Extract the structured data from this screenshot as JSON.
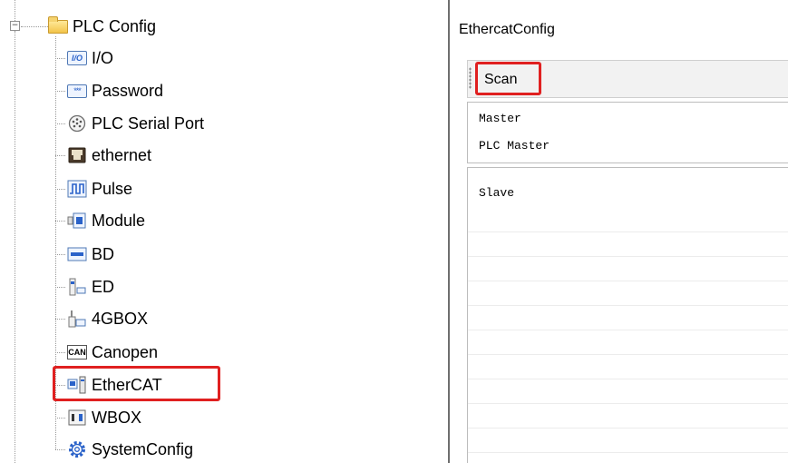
{
  "tree": {
    "root": {
      "label": "PLC Config",
      "expander": "−",
      "icon": "folder-icon"
    },
    "items": [
      {
        "label": "I/O",
        "icon": "io-icon",
        "icon_text": "I/O"
      },
      {
        "label": "Password",
        "icon": "password-icon",
        "icon_text": "***"
      },
      {
        "label": "PLC Serial Port",
        "icon": "serial-port-icon"
      },
      {
        "label": "ethernet",
        "icon": "ethernet-icon"
      },
      {
        "label": "Pulse",
        "icon": "pulse-icon"
      },
      {
        "label": "Module",
        "icon": "module-icon"
      },
      {
        "label": "BD",
        "icon": "bd-icon"
      },
      {
        "label": "ED",
        "icon": "ed-icon"
      },
      {
        "label": "4GBOX",
        "icon": "4gbox-icon"
      },
      {
        "label": "Canopen",
        "icon": "canopen-icon",
        "icon_text": "CAN"
      },
      {
        "label": "EtherCAT",
        "icon": "ethercat-icon",
        "highlighted": true
      },
      {
        "label": "WBOX",
        "icon": "wbox-icon"
      },
      {
        "label": "SystemConfig",
        "icon": "gear-icon"
      }
    ]
  },
  "config_panel": {
    "title": "EthercatConfig",
    "toolbar": {
      "scan_label": "Scan",
      "highlighted": true
    },
    "master_section": {
      "header": "Master",
      "rows": [
        "PLC Master"
      ]
    },
    "slave_section": {
      "header": "Slave",
      "rows": []
    }
  },
  "colors": {
    "highlight": "#e02020",
    "divider": "#6f6f6f",
    "folder": "#f3c44a",
    "icon_blue": "#2a62c9"
  }
}
